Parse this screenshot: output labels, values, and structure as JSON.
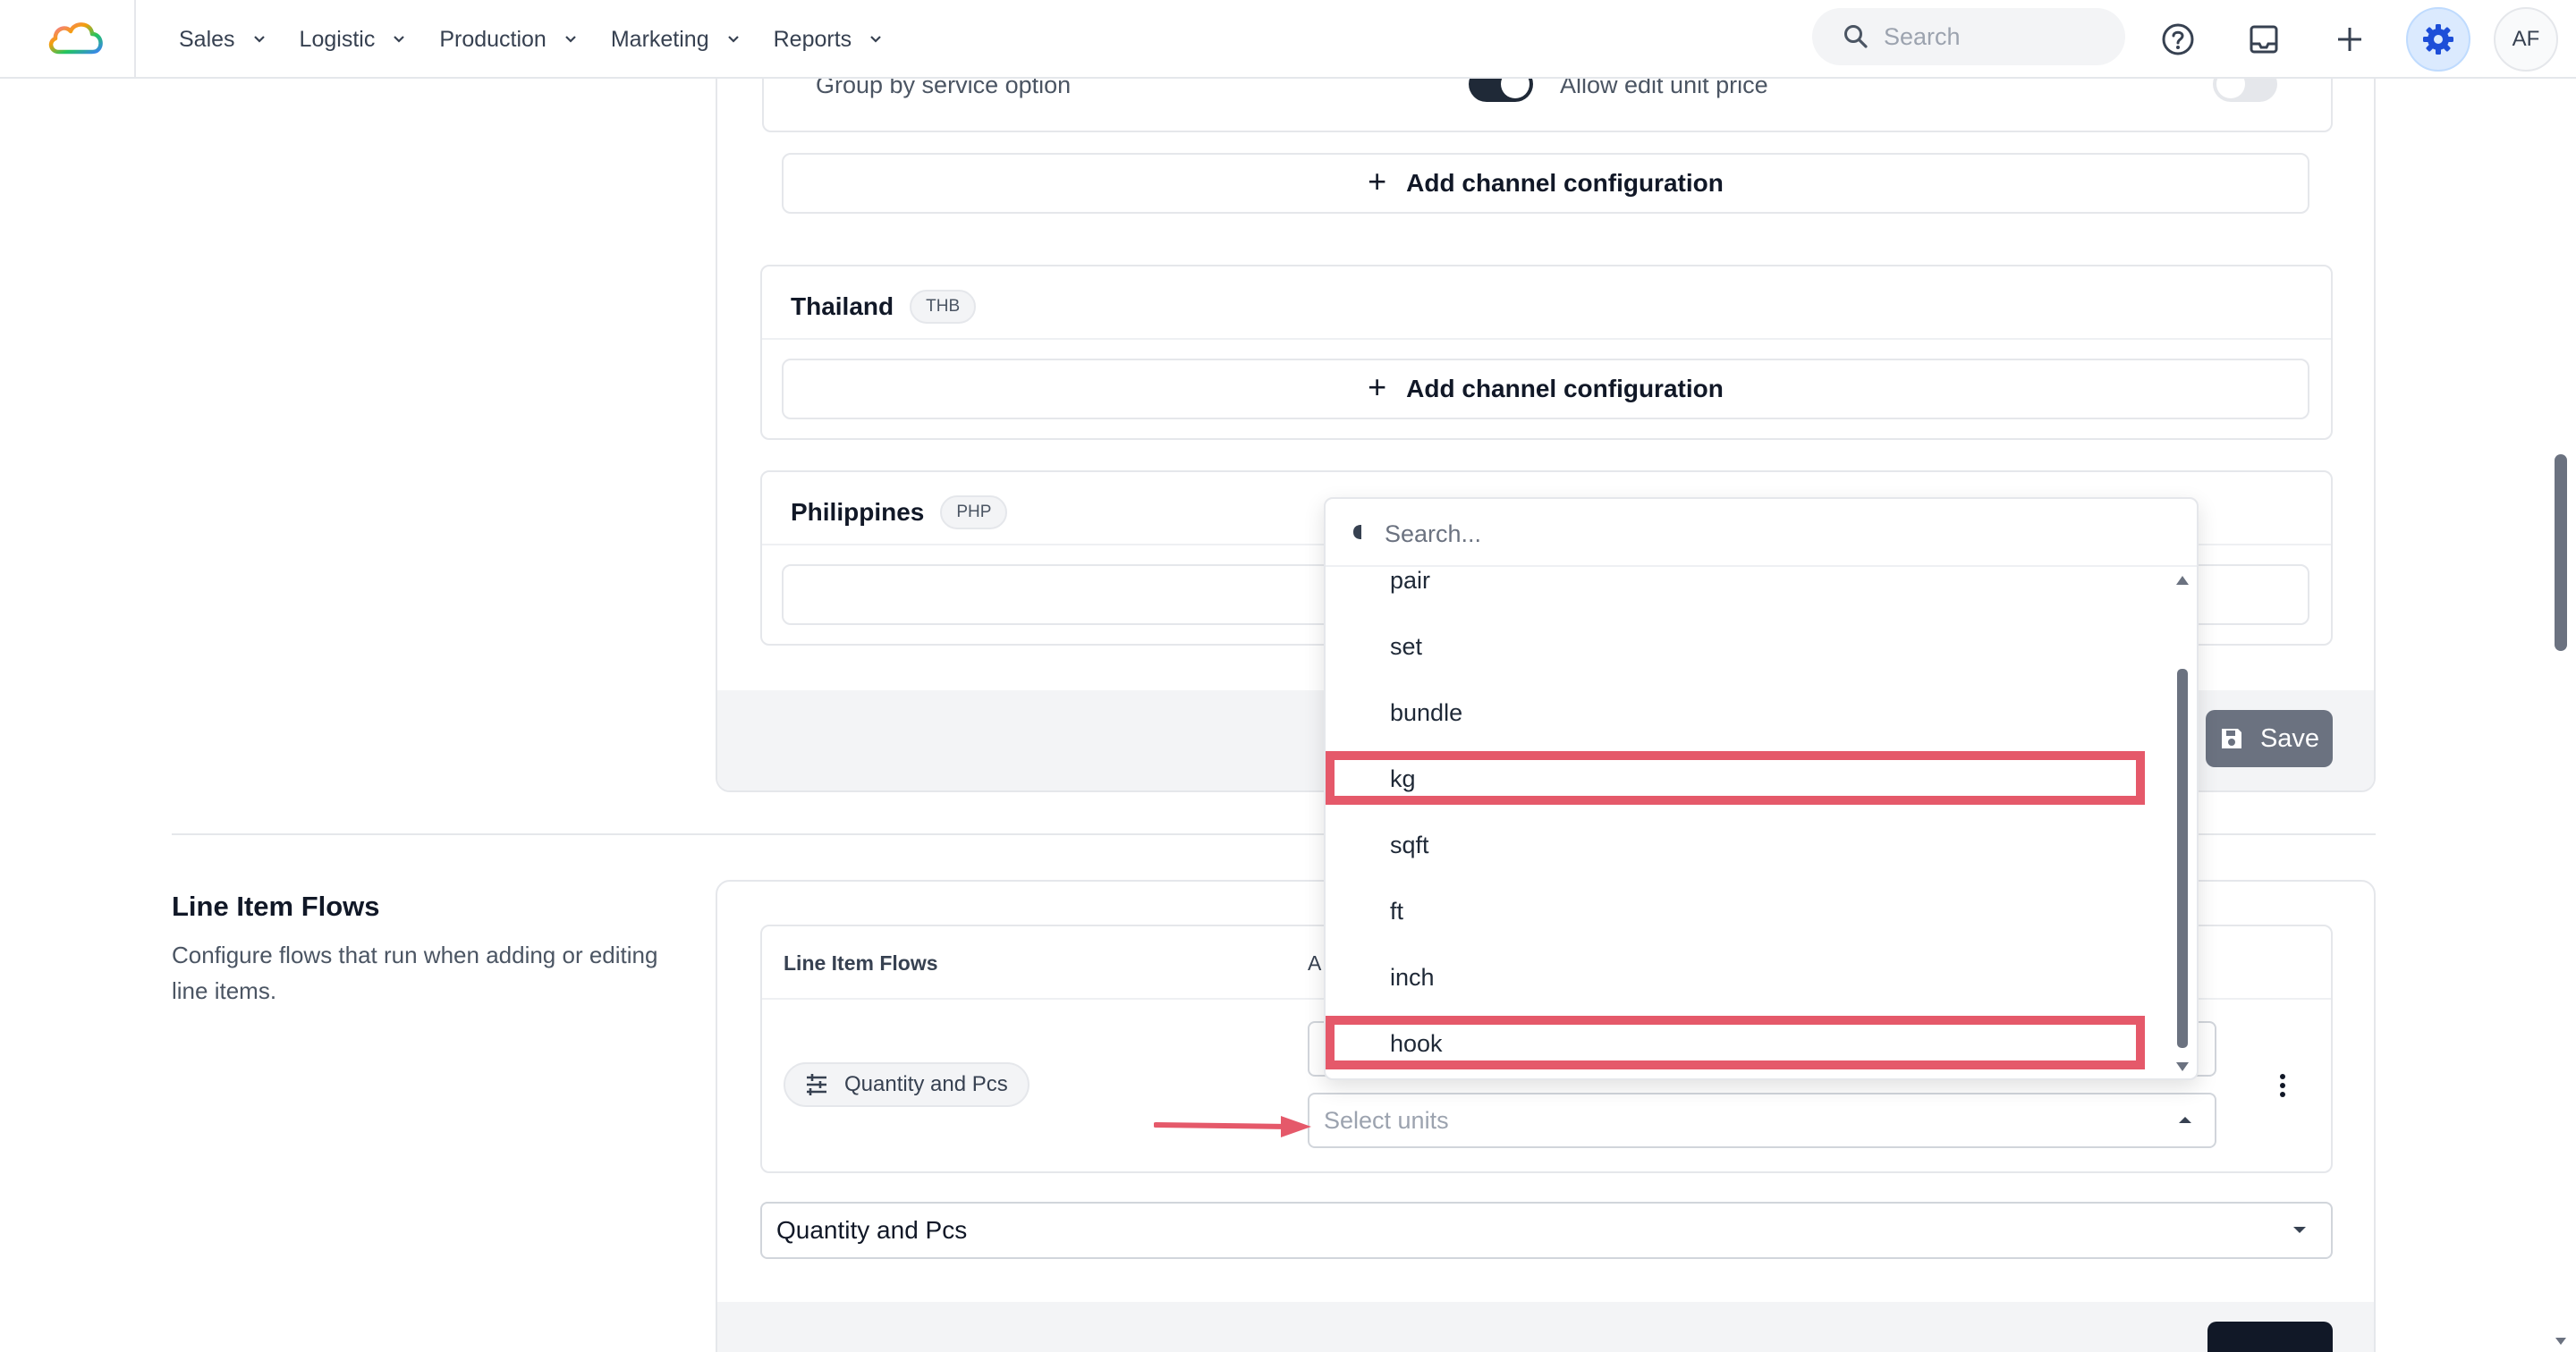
{
  "nav": {
    "items": [
      {
        "label": "Sales"
      },
      {
        "label": "Logistic"
      },
      {
        "label": "Production"
      },
      {
        "label": "Marketing"
      },
      {
        "label": "Reports"
      }
    ],
    "search_placeholder": "Search",
    "avatar_initials": "AF"
  },
  "channel_section": {
    "group_by_label": "Group by service option",
    "allow_edit_label": "Allow edit unit price",
    "group_by_enabled": true,
    "allow_edit_enabled": false,
    "add_channel_label": "Add channel configuration",
    "countries": [
      {
        "name": "Thailand",
        "currency": "THB"
      },
      {
        "name": "Philippines",
        "currency": "PHP"
      }
    ],
    "save_label": "Save"
  },
  "line_item_flows": {
    "title": "Line Item Flows",
    "description": "Configure flows that run when adding or editing line items.",
    "table_header_flows": "Line Item Flows",
    "table_header_second": "A",
    "flow_chip_label": "Quantity and Pcs",
    "select_units_placeholder": "Select units",
    "flow_select_value": "Quantity and Pcs"
  },
  "dropdown": {
    "search_placeholder": "Search...",
    "options": [
      "pair",
      "set",
      "bundle",
      "kg",
      "sqft",
      "ft",
      "inch",
      "hook"
    ],
    "highlighted": [
      "kg",
      "hook"
    ]
  },
  "colors": {
    "highlight": "#e5596a",
    "accent_blue": "#2563eb",
    "toggle_on": "#1f2937",
    "save_disabled": "#6b7280"
  }
}
